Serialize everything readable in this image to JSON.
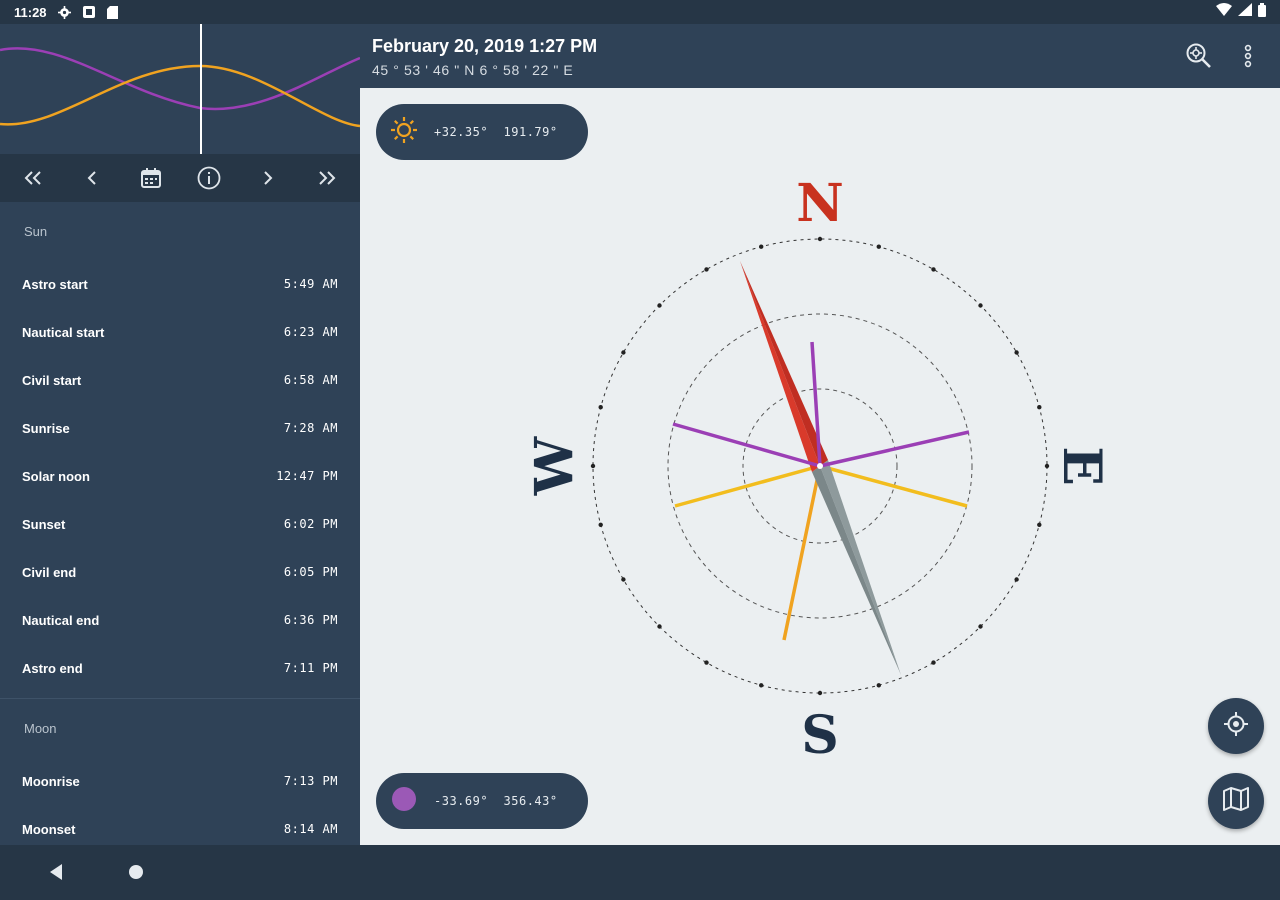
{
  "status_bar": {
    "time": "11:28",
    "icons": [
      "gear-icon",
      "square-icon",
      "sd-card-icon"
    ],
    "right_icons": [
      "wifi-icon",
      "signal-icon",
      "battery-icon"
    ]
  },
  "header": {
    "title": "February 20, 2019 1:27 PM",
    "subtitle": "45 ° 53 ' 46 \" N 6 ° 58 ' 22 \" E",
    "actions": [
      "zoom-search-icon",
      "more-vert-icon"
    ]
  },
  "graph": {
    "series": [
      {
        "color": "#9b3fb5"
      },
      {
        "color": "#f0a320"
      }
    ]
  },
  "nav": [
    "fast-rewind-icon",
    "previous-icon",
    "calendar-icon",
    "info-icon",
    "next-icon",
    "fast-forward-icon"
  ],
  "sun": {
    "section_title": "Sun",
    "rows": [
      {
        "label": "Astro start",
        "value": "5:49 AM"
      },
      {
        "label": "Nautical start",
        "value": "6:23 AM"
      },
      {
        "label": "Civil start",
        "value": "6:58 AM"
      },
      {
        "label": "Sunrise",
        "value": "7:28 AM"
      },
      {
        "label": "Solar noon",
        "value": "12:47 PM"
      },
      {
        "label": "Sunset",
        "value": "6:02 PM"
      },
      {
        "label": "Civil end",
        "value": "6:05 PM"
      },
      {
        "label": "Nautical end",
        "value": "6:36 PM"
      },
      {
        "label": "Astro end",
        "value": "7:11 PM"
      }
    ]
  },
  "moon": {
    "section_title": "Moon",
    "rows": [
      {
        "label": "Moonrise",
        "value": "7:13 PM"
      },
      {
        "label": "Moonset",
        "value": "8:14 AM"
      }
    ]
  },
  "compass": {
    "north": "N",
    "east": "E",
    "south": "S",
    "west": "W",
    "colors": {
      "north_needle": "#d93a2b",
      "south_needle": "#8e9a9c",
      "letter_n": "#c8321f",
      "letter_other": "#1f3147",
      "sun_rays": "#f0a320",
      "moon_rays": "#9b3fb5",
      "sun_rays_light": "#f2bd1e"
    }
  },
  "sun_position": {
    "text": "+32.35°  191.79°",
    "icon": "sun-icon",
    "color": "#f0a320"
  },
  "moon_position": {
    "text": "-33.69°  356.43°",
    "icon": "moon-icon",
    "color": "#9b59b6"
  },
  "fabs": [
    "my-location-icon",
    "map-icon"
  ],
  "bottom_nav": [
    "back-icon",
    "home-icon"
  ],
  "colors": {
    "panel": "#2f4257",
    "bar": "#263646",
    "main_bg": "#ebeff1"
  }
}
